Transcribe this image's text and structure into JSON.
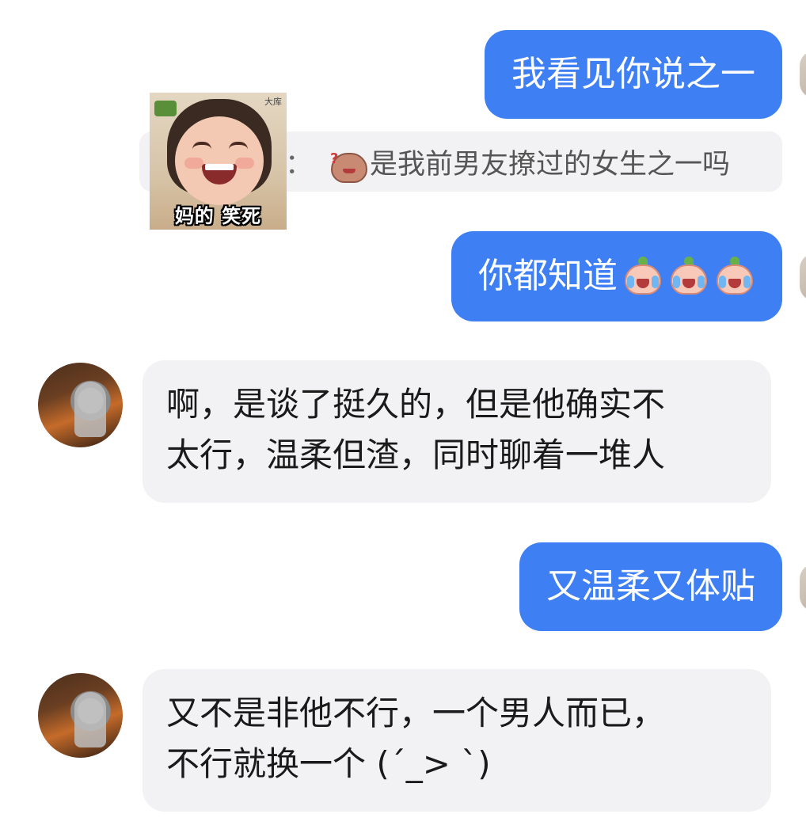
{
  "messages": {
    "out_1": "我看见你说之一",
    "quote": {
      "colon": "：",
      "text": "是我前男友撩过的女生之一吗",
      "emoji": "bun-grumpy-emoji"
    },
    "sticker_caption": "妈的 笑死",
    "sticker_watermark": "大库",
    "out_2": "你都知道",
    "out_2_emojis": [
      "bun-crying-laugh-emoji",
      "bun-crying-laugh-emoji",
      "bun-crying-laugh-emoji"
    ],
    "in_1": {
      "line1": "啊，是谈了挺久的，但是他确实不",
      "line2": "太行，温柔但渣，同时聊着一堆人"
    },
    "out_3": "又温柔又体贴",
    "in_2": {
      "line1": "又不是非他不行，一个男人而已，",
      "line2": "不行就换一个 (´_> `)"
    }
  },
  "colors": {
    "outgoing_bubble": "#3e7ff4",
    "incoming_bubble": "#f2f2f4",
    "incoming_text": "#1a1a1a",
    "outgoing_text": "#ffffff"
  }
}
